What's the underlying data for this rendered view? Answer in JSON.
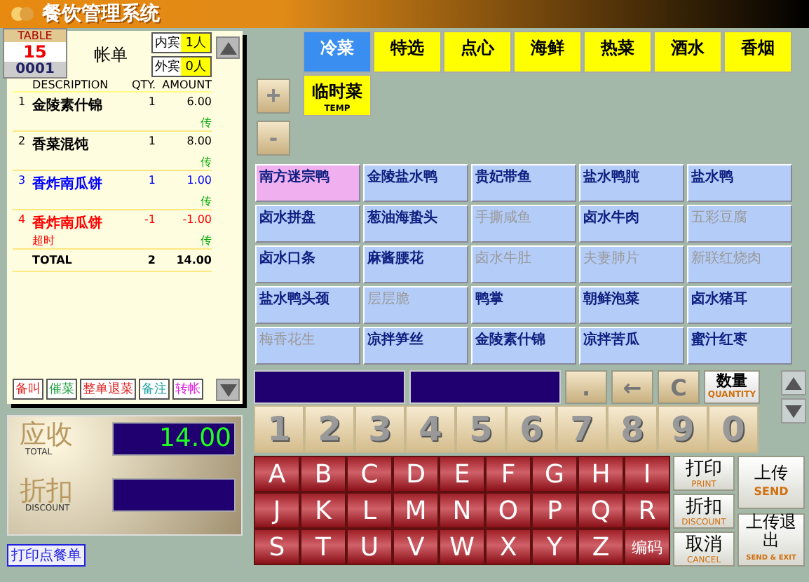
{
  "window": {
    "title": "餐饮管理系统"
  },
  "table": {
    "label": "TABLE",
    "number": "15",
    "code": "0001"
  },
  "bill": {
    "title": "帐单",
    "guests": [
      {
        "label": "内宾",
        "count": "1人"
      },
      {
        "label": "外宾",
        "count": "0人"
      }
    ],
    "columns": [
      "DESCRIPTION",
      "QTY.",
      "AMOUNT"
    ],
    "items": [
      {
        "index": "1",
        "name": "金陵素什锦",
        "qty": "1",
        "amount": "6.00",
        "mark": "传",
        "color": "#000000"
      },
      {
        "index": "2",
        "name": "香菜混饨",
        "qty": "1",
        "amount": "8.00",
        "mark": "传",
        "color": "#000000"
      },
      {
        "index": "3",
        "name": "香炸南瓜饼",
        "qty": "1",
        "amount": "1.00",
        "mark": "传",
        "color": "#0000ff"
      },
      {
        "index": "4",
        "name": "香炸南瓜饼",
        "note": "超时",
        "qty": "-1",
        "amount": "-1.00",
        "mark": "传",
        "color": "#ff0000"
      }
    ],
    "total": {
      "label": "TOTAL",
      "qty": "2",
      "amount": "14.00"
    },
    "actions": [
      {
        "label": "备叫",
        "color": "#e02020"
      },
      {
        "label": "催菜",
        "color": "#20a040"
      },
      {
        "label": "整单退菜",
        "color": "#e02020"
      },
      {
        "label": "备注",
        "color": "#20a0a0"
      },
      {
        "label": "转帐",
        "color": "#e020e0"
      }
    ]
  },
  "totals": {
    "receivable_label": "应收",
    "receivable_sub": "TOTAL",
    "receivable": "14.00",
    "discount_label": "折扣",
    "discount_sub": "DISCOUNT"
  },
  "print_link": "打印点餐单",
  "categories": [
    {
      "label": "冷菜",
      "selected": true
    },
    {
      "label": "特选",
      "selected": false
    },
    {
      "label": "点心",
      "selected": false
    },
    {
      "label": "海鲜",
      "selected": false
    },
    {
      "label": "热菜",
      "selected": false
    },
    {
      "label": "酒水",
      "selected": false
    },
    {
      "label": "香烟",
      "selected": false
    }
  ],
  "temp_category": {
    "label": "临时菜",
    "sub": "TEMP"
  },
  "zoom_buttons": [
    "+",
    "-"
  ],
  "dishes": [
    {
      "name": "南方迷宗鸭",
      "available": true,
      "selected": true
    },
    {
      "name": "金陵盐水鸭",
      "available": true,
      "selected": false
    },
    {
      "name": "贵妃带鱼",
      "available": true,
      "selected": false
    },
    {
      "name": "盐水鸭肫",
      "available": true,
      "selected": false
    },
    {
      "name": "盐水鸭",
      "available": true,
      "selected": false
    },
    {
      "name": "卤水拼盘",
      "available": true,
      "selected": false
    },
    {
      "name": "葱油海蛰头",
      "available": true,
      "selected": false
    },
    {
      "name": "手撕咸鱼",
      "available": false,
      "selected": false
    },
    {
      "name": "卤水牛肉",
      "available": true,
      "selected": false
    },
    {
      "name": "五彩豆腐",
      "available": false,
      "selected": false
    },
    {
      "name": "卤水口条",
      "available": true,
      "selected": false
    },
    {
      "name": "麻酱腰花",
      "available": true,
      "selected": false
    },
    {
      "name": "卤水牛肚",
      "available": false,
      "selected": false
    },
    {
      "name": "夫妻肺片",
      "available": false,
      "selected": false
    },
    {
      "name": "新联红烧肉",
      "available": false,
      "selected": false
    },
    {
      "name": "盐水鸭头颈",
      "available": true,
      "selected": false
    },
    {
      "name": "层层脆",
      "available": false,
      "selected": false
    },
    {
      "name": "鸭掌",
      "available": true,
      "selected": false
    },
    {
      "name": "朝鲜泡菜",
      "available": true,
      "selected": false
    },
    {
      "name": "卤水猪耳",
      "available": true,
      "selected": false
    },
    {
      "name": "梅香花生",
      "available": false,
      "selected": false
    },
    {
      "name": "凉拌笋丝",
      "available": true,
      "selected": false
    },
    {
      "name": "金陵素什锦",
      "available": true,
      "selected": false
    },
    {
      "name": "凉拌苦瓜",
      "available": true,
      "selected": false
    },
    {
      "name": "蜜汁红枣",
      "available": true,
      "selected": false
    }
  ],
  "edit_keys": [
    ".",
    "←",
    "C"
  ],
  "quantity_key": {
    "label": "数量",
    "sub": "QUANTITY"
  },
  "digits": [
    "1",
    "2",
    "3",
    "4",
    "5",
    "6",
    "7",
    "8",
    "9",
    "0"
  ],
  "letters": [
    "A",
    "B",
    "C",
    "D",
    "E",
    "F",
    "G",
    "H",
    "I",
    "J",
    "K",
    "L",
    "M",
    "N",
    "O",
    "P",
    "Q",
    "R",
    "S",
    "T",
    "U",
    "V",
    "W",
    "X",
    "Y",
    "Z",
    "编码"
  ],
  "function_keys": [
    {
      "label": "打印",
      "sub": "PRINT"
    },
    {
      "label": "折扣",
      "sub": "DISCOUNT"
    },
    {
      "label": "取消",
      "sub": "CANCEL"
    }
  ],
  "send_keys": [
    {
      "label": "上传",
      "sub": "SEND"
    },
    {
      "label": "上传退出",
      "sub": "SEND & EXIT"
    }
  ]
}
